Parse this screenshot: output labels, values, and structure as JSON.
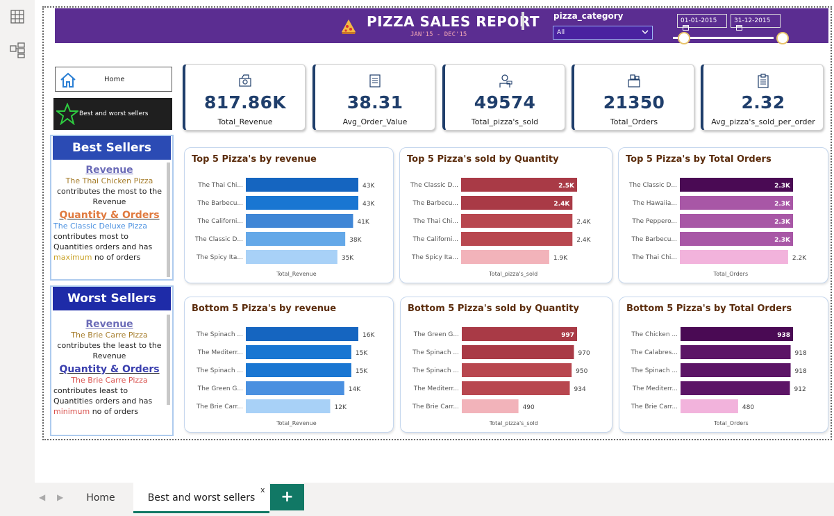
{
  "header": {
    "title": "PIZZA SALES REPORT",
    "subtitle": "JAN'15 - DEC'15",
    "slicer_label": "pizza_category",
    "slicer_value": "All",
    "date_start": "01-01-2015",
    "date_end": "31-12-2015"
  },
  "nav": {
    "home_label": "Home",
    "best_label": "Best and worst sellers"
  },
  "best": {
    "heading": "Best Sellers",
    "revenue_title": "Revenue",
    "revenue_pizza": "The Thai Chicken Pizza",
    "revenue_text": "contributes the most to the Revenue",
    "qo_title_q": "Quantity",
    "qo_amp": "&",
    "qo_title_o": "Orders",
    "qo_pizza": "The Classic Deluxe Pizza",
    "qo_text1": "contributes most to Quantities orders and has",
    "qo_word": "maximum",
    "qo_text2": "no of orders"
  },
  "worst": {
    "heading": "Worst Sellers",
    "revenue_title": "Revenue",
    "revenue_pizza": "The Brie Carre Pizza",
    "revenue_text": "contributes the least to the Revenue",
    "qo_title_q": "Quantity",
    "qo_amp": "&",
    "qo_title_o": "Orders",
    "qo_pizza": "The Brie Carre Pizza",
    "qo_text1": "contributes least to Quantities orders and has",
    "qo_word": "minimum",
    "qo_text2": "no of orders"
  },
  "kpis": [
    {
      "value": "817.86K",
      "label": "Total_Revenue",
      "icon": "money-icon"
    },
    {
      "value": "38.31",
      "label": "Avg_Order_Value",
      "icon": "receipt-icon"
    },
    {
      "value": "49574",
      "label": "Total_pizza's_sold",
      "icon": "chef-icon"
    },
    {
      "value": "21350",
      "label": "Total_Orders",
      "icon": "orders-icon"
    },
    {
      "value": "2.32",
      "label": "Avg_pizza's_sold_per_order",
      "icon": "clipboard-icon"
    }
  ],
  "tabs": {
    "home": "Home",
    "active": "Best and worst sellers",
    "close": "x",
    "add": "+"
  },
  "colors": {
    "header_bg": "#5b2d91",
    "kpi_value": "#1f3e6b",
    "tab_accent": "#117865"
  },
  "chart_data": [
    {
      "type": "bar",
      "title": "Top 5 Pizza's by revenue",
      "xlabel": "Total_Revenue",
      "categories": [
        "The Thai Chi...",
        "The Barbecu...",
        "The Californi...",
        "The Classic D...",
        "The Spicy Ita..."
      ],
      "values": [
        43,
        43,
        41,
        38,
        35
      ],
      "labels": [
        "43K",
        "43K",
        "41K",
        "38K",
        "35K"
      ],
      "colors": [
        "#1565c0",
        "#1976d2",
        "#3f86d6",
        "#64a8e8",
        "#a8d1f7"
      ],
      "max": 43
    },
    {
      "type": "bar",
      "title": "Top 5 Pizza's sold by Quantity",
      "xlabel": "Total_pizza's_sold",
      "categories": [
        "The Classic D...",
        "The Barbecu...",
        "The Thai Chi...",
        "The Californi...",
        "The Spicy Ita..."
      ],
      "values": [
        2.5,
        2.4,
        2.4,
        2.4,
        1.9
      ],
      "labels": [
        "2.5K",
        "2.4K",
        "2.4K",
        "2.4K",
        "1.9K"
      ],
      "colors": [
        "#a93a46",
        "#a93a46",
        "#b8474f",
        "#b8474f",
        "#f2b3ba"
      ],
      "max": 2.5
    },
    {
      "type": "bar",
      "title": "Top 5 Pizza's by Total Orders",
      "xlabel": "Total_Orders",
      "categories": [
        "The Classic D...",
        "The Hawaiia...",
        "The Peppero...",
        "The Barbecu...",
        "The Thai Chi..."
      ],
      "values": [
        2.3,
        2.3,
        2.3,
        2.3,
        2.2
      ],
      "labels": [
        "2.3K",
        "2.3K",
        "2.3K",
        "2.3K",
        "2.2K"
      ],
      "colors": [
        "#4a0a54",
        "#a857a6",
        "#a857a6",
        "#a857a6",
        "#f2b3dc"
      ],
      "max": 2.3
    },
    {
      "type": "bar",
      "title": "Bottom 5 Pizza's by revenue",
      "xlabel": "Total_Revenue",
      "categories": [
        "The Spinach ...",
        "The Mediterr...",
        "The Spinach ...",
        "The Green G...",
        "The Brie Carr..."
      ],
      "values": [
        16,
        15,
        15,
        14,
        12
      ],
      "labels": [
        "16K",
        "15K",
        "15K",
        "14K",
        "12K"
      ],
      "colors": [
        "#1565c0",
        "#1976d2",
        "#1976d2",
        "#4a90e0",
        "#a8d1f7"
      ],
      "max": 16
    },
    {
      "type": "bar",
      "title": "Bottom 5 Pizza's sold by Quantity",
      "xlabel": "Total_pizza's_sold",
      "categories": [
        "The Green G...",
        "The Spinach ...",
        "The Spinach ...",
        "The Mediterr...",
        "The Brie Carr..."
      ],
      "values": [
        997,
        970,
        950,
        934,
        490
      ],
      "labels": [
        "997",
        "970",
        "950",
        "934",
        "490"
      ],
      "colors": [
        "#a93a46",
        "#a93a46",
        "#b8474f",
        "#b8474f",
        "#f2b3ba"
      ],
      "max": 997
    },
    {
      "type": "bar",
      "title": "Bottom 5 Pizza's by Total Orders",
      "xlabel": "Total_Orders",
      "categories": [
        "The Chicken ...",
        "The Calabres...",
        "The Spinach ...",
        "The Mediterr...",
        "The Brie Carr..."
      ],
      "values": [
        938,
        918,
        918,
        912,
        480
      ],
      "labels": [
        "938",
        "918",
        "918",
        "912",
        "480"
      ],
      "colors": [
        "#4a0a54",
        "#5c1566",
        "#5c1566",
        "#5c1566",
        "#f2b3dc"
      ],
      "max": 938
    }
  ]
}
